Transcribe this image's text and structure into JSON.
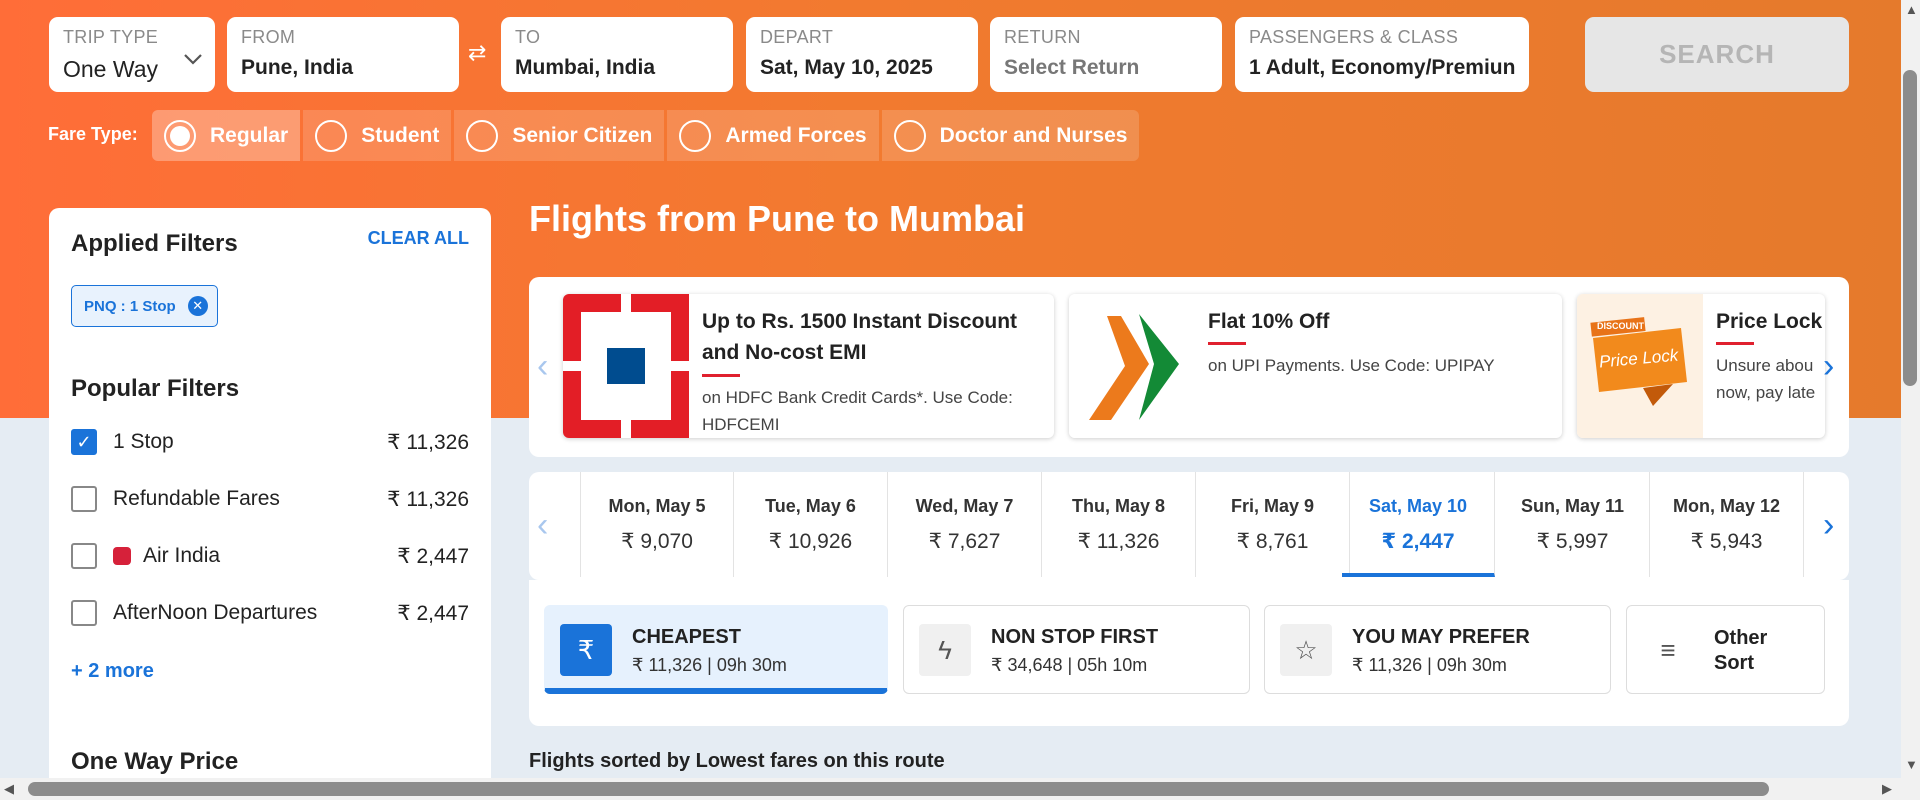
{
  "search": {
    "trip_type": {
      "label": "TRIP TYPE",
      "value": "One Way"
    },
    "from": {
      "label": "FROM",
      "value": "Pune, India"
    },
    "to": {
      "label": "TO",
      "value": "Mumbai, India"
    },
    "depart": {
      "label": "DEPART",
      "value": "Sat, May 10, 2025"
    },
    "return": {
      "label": "RETURN",
      "value": "Select Return"
    },
    "passengers": {
      "label": "PASSENGERS & CLASS",
      "value": "1 Adult, Economy/Premiun"
    },
    "search_button": "SEARCH",
    "swap_icon": "⇄"
  },
  "fare_type": {
    "label": "Fare Type:",
    "options": [
      {
        "label": "Regular",
        "selected": true
      },
      {
        "label": "Student",
        "selected": false
      },
      {
        "label": "Senior Citizen",
        "selected": false
      },
      {
        "label": "Armed Forces",
        "selected": false
      },
      {
        "label": "Doctor and Nurses",
        "selected": false
      }
    ]
  },
  "sidebar": {
    "applied_title": "Applied Filters",
    "clear_all": "CLEAR ALL",
    "chip": "PNQ : 1 Stop",
    "popular_title": "Popular Filters",
    "filters": [
      {
        "name": "1 Stop",
        "price": "₹ 11,326",
        "checked": true
      },
      {
        "name": "Refundable Fares",
        "price": "₹ 11,326",
        "checked": false
      },
      {
        "name": "Air India",
        "price": "₹ 2,447",
        "checked": false
      },
      {
        "name": "AfterNoon Departures",
        "price": "₹ 2,447",
        "checked": false
      }
    ],
    "more": "+ 2 more",
    "price_title": "One Way Price"
  },
  "main": {
    "title": "Flights from Pune to Mumbai",
    "offers": [
      {
        "head1": "Up to Rs. 1500 Instant Discount",
        "head2": "and No-cost EMI",
        "sub1": "on HDFC Bank Credit Cards*. Use Code:",
        "sub2": "HDFCEMI"
      },
      {
        "head1": "Flat 10% Off",
        "sub1": "on UPI Payments. Use Code: UPIPAY"
      },
      {
        "head1": "Price Lock",
        "sub1": "Unsure abou",
        "sub2": "now, pay late",
        "badge_top": "DISCOUNT",
        "badge_text": "Price Lock"
      }
    ],
    "dates": [
      {
        "date": "Mon, May 5",
        "price": "₹ 9,070"
      },
      {
        "date": "Tue, May 6",
        "price": "₹ 10,926"
      },
      {
        "date": "Wed, May 7",
        "price": "₹ 7,627"
      },
      {
        "date": "Thu, May 8",
        "price": "₹ 11,326"
      },
      {
        "date": "Fri, May 9",
        "price": "₹ 8,761"
      },
      {
        "date": "Sat, May 10",
        "price": "₹ 2,447"
      },
      {
        "date": "Sun, May 11",
        "price": "₹ 5,997"
      },
      {
        "date": "Mon, May 12",
        "price": "₹ 5,943"
      }
    ],
    "sorts": [
      {
        "title": "CHEAPEST",
        "sub": "₹ 11,326 | 09h 30m",
        "icon": "₹"
      },
      {
        "title": "NON STOP FIRST",
        "sub": "₹ 34,648 | 05h 10m",
        "icon": "ϟ"
      },
      {
        "title": "YOU MAY PREFER",
        "sub": "₹ 11,326 | 09h 30m",
        "icon": "☆"
      },
      {
        "title": "Other",
        "title2": "Sort",
        "icon": "≡"
      }
    ],
    "sorted_note": "Flights sorted by Lowest fares on this route"
  },
  "colors": {
    "accent": "#1a73d9",
    "hero_start": "#ff6d38",
    "hero_end": "#e57a2c",
    "hdfc_red": "#e0202e"
  }
}
